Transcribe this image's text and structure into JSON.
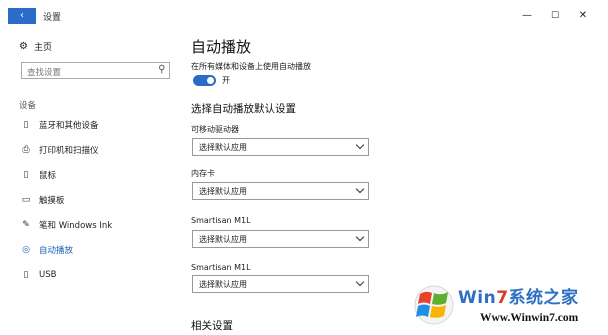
{
  "window": {
    "title": "设置",
    "back": "‹",
    "minimize": "—",
    "maximize": "☐",
    "close": "✕"
  },
  "sidebar": {
    "home": "主页",
    "search_placeholder": "查找设置",
    "group": "设备",
    "items": [
      {
        "label": "蓝牙和其他设备",
        "icon": "bluetooth-devices-icon",
        "glyph": "▯"
      },
      {
        "label": "打印机和扫描仪",
        "icon": "printer-icon",
        "glyph": "⎙"
      },
      {
        "label": "鼠标",
        "icon": "mouse-icon",
        "glyph": "▯"
      },
      {
        "label": "触摸板",
        "icon": "touchpad-icon",
        "glyph": "▭"
      },
      {
        "label": "笔和 Windows Ink",
        "icon": "pen-icon",
        "glyph": "✎"
      },
      {
        "label": "自动播放",
        "icon": "autoplay-icon",
        "glyph": "◎",
        "active": true
      },
      {
        "label": "USB",
        "icon": "usb-icon",
        "glyph": "▯"
      }
    ]
  },
  "main": {
    "title": "自动播放",
    "toggle_description": "在所有媒体和设备上使用自动播放",
    "toggle_state": "开",
    "defaults_heading": "选择自动播放默认设置",
    "fields": [
      {
        "label": "可移动驱动器",
        "value": "选择默认应用"
      },
      {
        "label": "内存卡",
        "value": "选择默认应用"
      },
      {
        "label": "Smartisan M1L",
        "value": "选择默认应用"
      },
      {
        "label": "Smartisan M1L",
        "value": "选择默认应用"
      }
    ],
    "related_heading": "相关设置"
  },
  "watermark": {
    "brand_a": "Win",
    "brand_b": "7",
    "brand_c": "系统之家",
    "url": "Www.Winwin7.com"
  },
  "colors": {
    "accent": "#2b6cc9",
    "active_nav": "#1a5fb4"
  }
}
